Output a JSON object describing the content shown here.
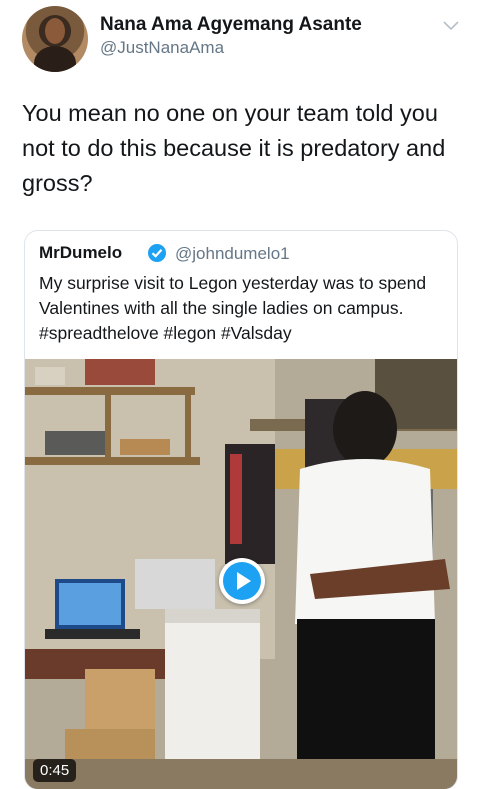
{
  "tweet": {
    "display_name": "Nana Ama Agyemang Asante",
    "handle": "@JustNanaAma",
    "text": "You mean no one on your team told you not to do this because it is predatory and gross?",
    "menu_icon": "chevron-down-icon"
  },
  "quoted_tweet": {
    "display_name": "MrDumelo",
    "verified_icon": "verified-badge-icon",
    "handle": "@johndumelo1",
    "text": "My surprise visit to Legon yesterday was to spend Valentines with all the single ladies on campus. #spreadthelove #legon #Valsday",
    "video": {
      "duration": "0:45",
      "play_icon": "play-icon"
    }
  },
  "colors": {
    "text_primary": "#14171a",
    "text_secondary": "#657786",
    "accent": "#1da1f2",
    "border": "#dfe4ea"
  }
}
